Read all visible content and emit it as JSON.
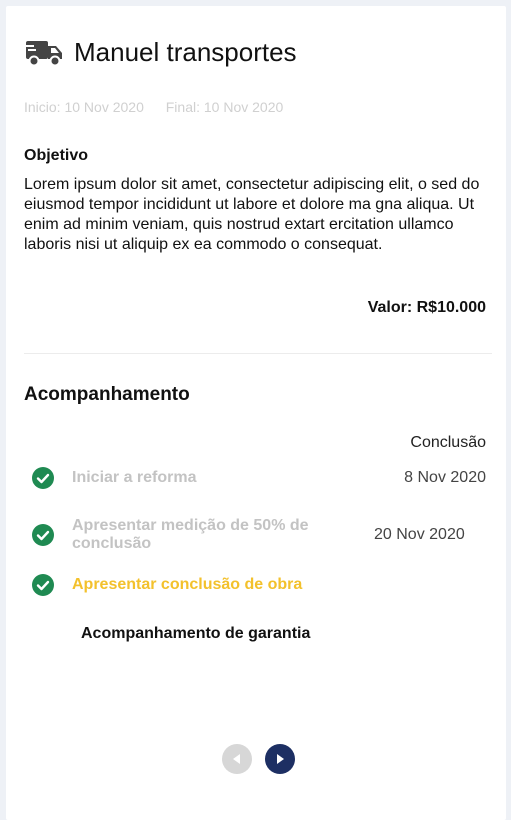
{
  "header": {
    "title": "Manuel transportes",
    "icon": "truck-icon"
  },
  "dates": {
    "start": "Inicio: 10 Nov 2020",
    "end": "Final: 10 Nov 2020"
  },
  "objective": {
    "label": "Objetivo",
    "text": "Lorem ipsum dolor sit amet, consectetur adipiscing elit, o sed do eiusmod tempor incididunt ut labore et dolore ma gna aliqua. Ut enim ad minim veniam, quis nostrud extart ercitation ullamco laboris nisi ut aliquip ex ea commodo o consequat."
  },
  "valor": "Valor: R$10.000",
  "tracking": {
    "title": "Acompanhamento",
    "column_header": "Conclusão",
    "steps": [
      {
        "label": "Iniciar a reforma",
        "date": "8 Nov 2020",
        "done": true,
        "state": "muted"
      },
      {
        "label": "Apresentar  medição de 50% de conclusão",
        "date": "20 Nov 2020",
        "done": true,
        "state": "muted"
      },
      {
        "label": "Apresentar conclusão de obra",
        "date": "",
        "done": true,
        "state": "active"
      }
    ],
    "warranty": "Acompanhamento de garantia"
  },
  "colors": {
    "check": "#1f8a52",
    "active_step": "#f3c12c",
    "muted_step": "#c3c3c3",
    "pager_active": "#1d2f63",
    "pager_inactive": "#d7d7d7"
  }
}
